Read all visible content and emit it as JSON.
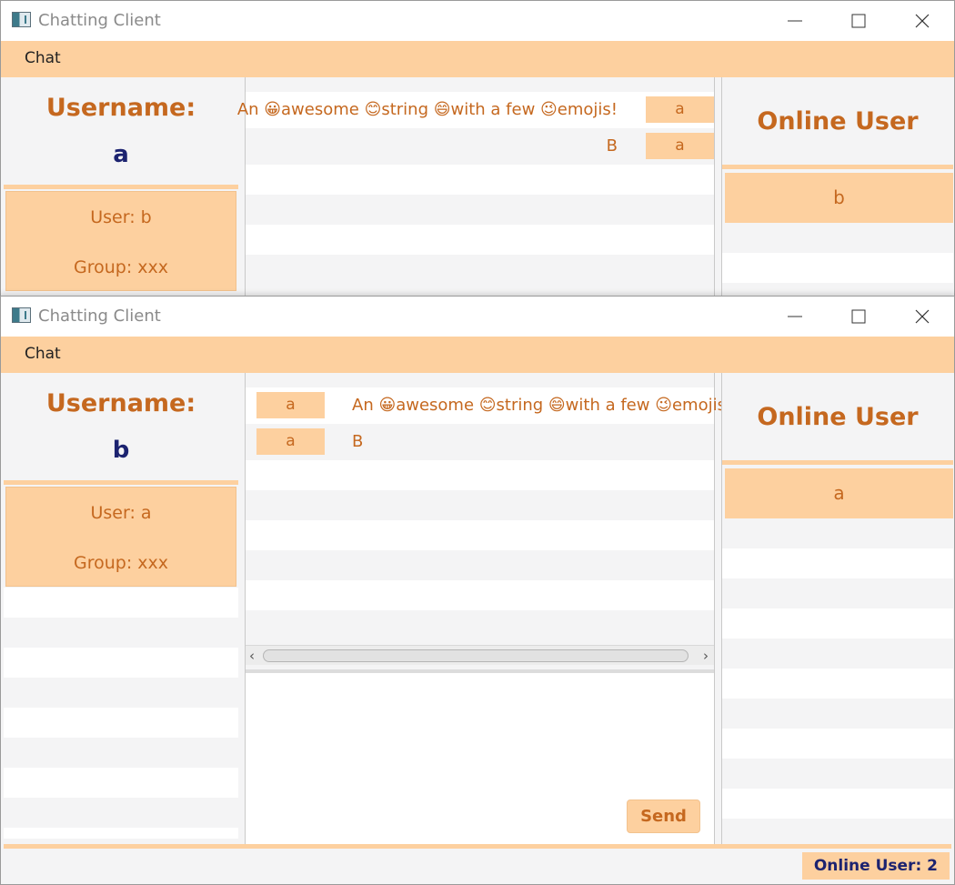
{
  "colors": {
    "accent_peach": "#fdd09f",
    "accent_text_orange": "#c5681f",
    "username_navy": "#1c2370",
    "panel_gray": "#f4f4f5"
  },
  "window1": {
    "title": "Chatting Client",
    "menu": {
      "chat": "Chat"
    },
    "user_panel": {
      "label": "Username:",
      "value": "a"
    },
    "contact_card": {
      "user": "User: b",
      "group": "Group: xxx"
    },
    "messages": [
      {
        "text": "An 😀awesome 😊string 😄with a few 😉emojis!",
        "sender": "a"
      },
      {
        "text": "B",
        "sender": "a"
      }
    ],
    "online": {
      "title": "Online User",
      "users": [
        "b"
      ]
    }
  },
  "window2": {
    "title": "Chatting Client",
    "menu": {
      "chat": "Chat"
    },
    "user_panel": {
      "label": "Username:",
      "value": "b"
    },
    "contact_card": {
      "user": "User: a",
      "group": "Group: xxx"
    },
    "messages": [
      {
        "sender": "a",
        "text": "An 😀awesome 😊string 😄with a few 😉emojis!"
      },
      {
        "sender": "a",
        "text": "B"
      }
    ],
    "compose": {
      "send_label": "Send",
      "value": ""
    },
    "online": {
      "title": "Online User",
      "users": [
        "a"
      ]
    },
    "status": {
      "online_count": "Online User: 2"
    }
  },
  "icons": {
    "app": "app-window-icon",
    "minimize": "minimize-icon",
    "maximize": "maximize-icon",
    "close": "close-icon",
    "scroll_left": "chevron-left-icon",
    "scroll_right": "chevron-right-icon"
  }
}
